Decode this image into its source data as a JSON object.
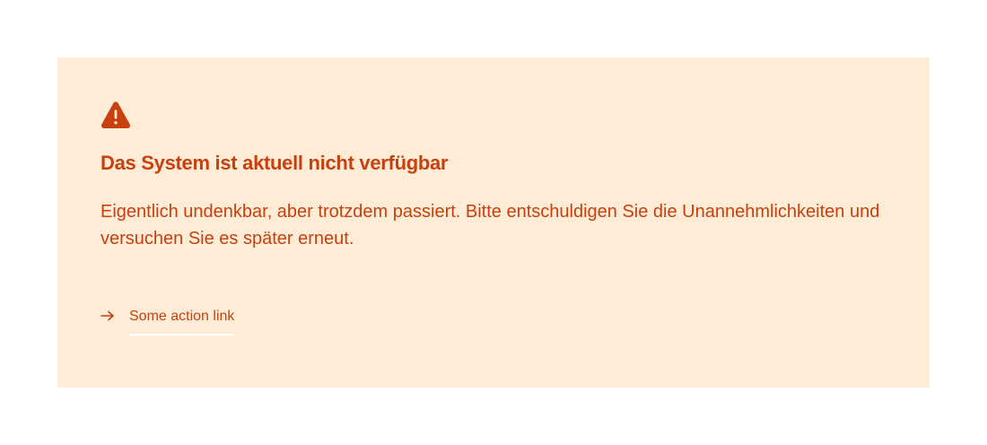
{
  "alert": {
    "icon": "warning-triangle-icon",
    "title": "Das System ist aktuell nicht verfügbar",
    "message": "Eigentlich undenkbar, aber trotzdem passiert. Bitte entschuldigen Sie die Unannehmlichkeiten und versuchen Sie es später erneut.",
    "action": {
      "icon": "arrow-right-icon",
      "label": "Some action link"
    }
  },
  "colors": {
    "background": "#ffecd6",
    "accent": "#c8400e",
    "page": "#ffffff"
  }
}
